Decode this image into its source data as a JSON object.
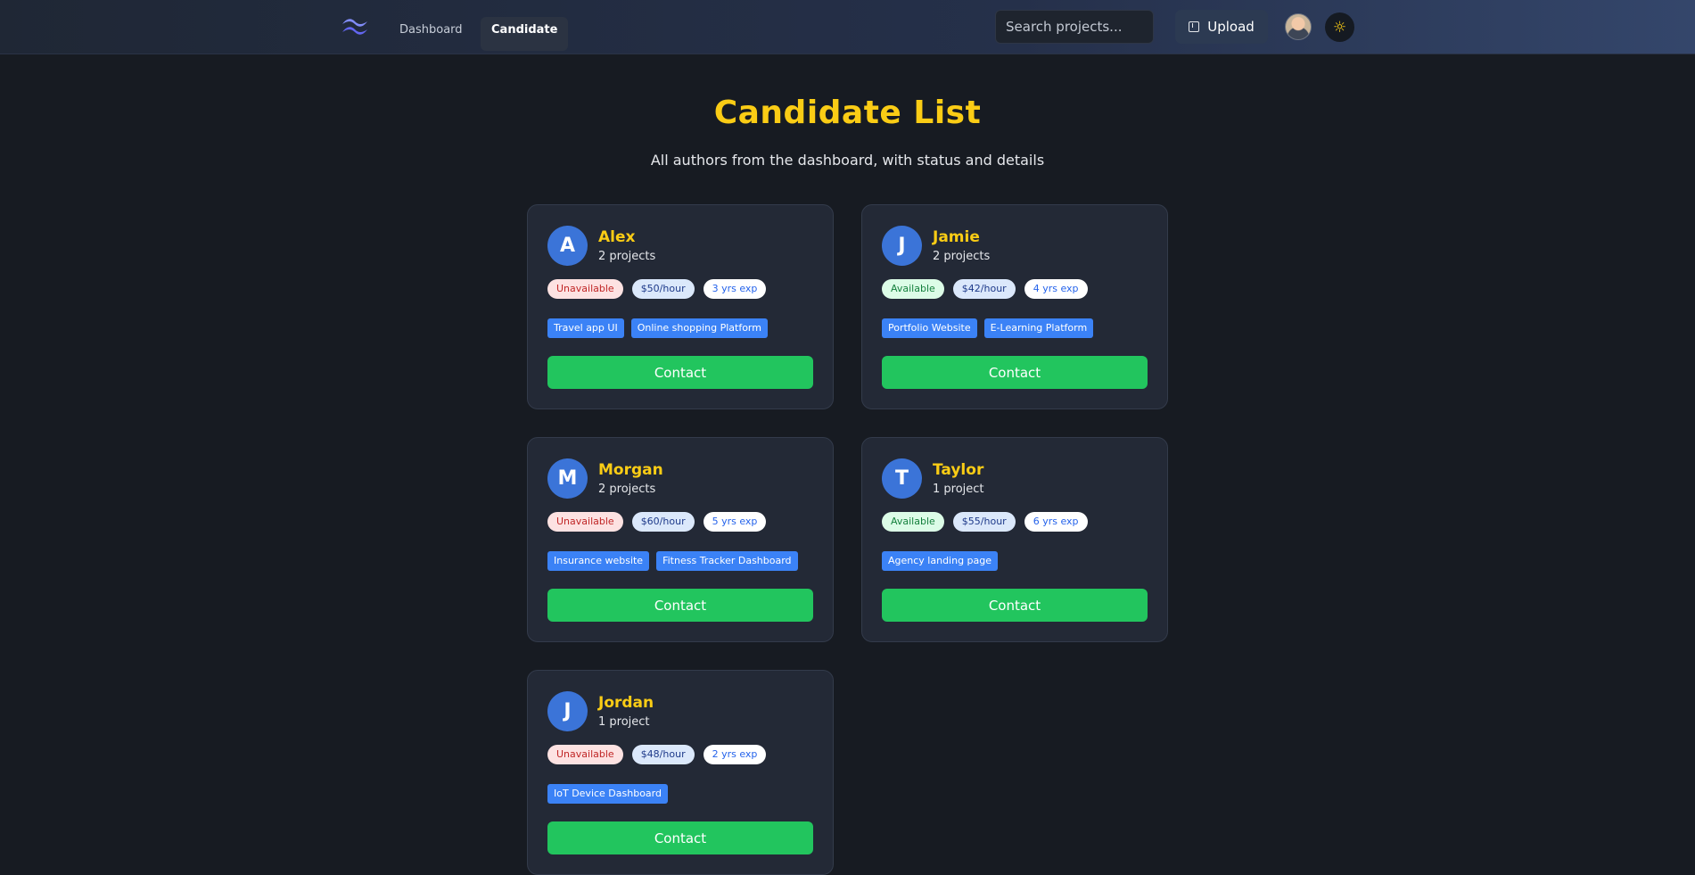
{
  "nav": {
    "links": [
      {
        "label": "Dashboard"
      },
      {
        "label": "Candidate"
      }
    ],
    "search_placeholder": "Search projects...",
    "upload_label": "Upload",
    "theme_icon": "☼"
  },
  "header": {
    "title": "Candidate List",
    "subtitle": "All authors from the dashboard, with status and details"
  },
  "candidates": [
    {
      "initial": "A",
      "name": "Alex",
      "projects": "2 projects",
      "status": "Unavailable",
      "rate": "$50/hour",
      "experience": "3 yrs exp",
      "tags": [
        "Travel app UI",
        "Online shopping Platform"
      ],
      "contact_label": "Contact"
    },
    {
      "initial": "J",
      "name": "Jamie",
      "projects": "2 projects",
      "status": "Available",
      "rate": "$42/hour",
      "experience": "4 yrs exp",
      "tags": [
        "Portfolio Website",
        "E-Learning Platform"
      ],
      "contact_label": "Contact"
    },
    {
      "initial": "M",
      "name": "Morgan",
      "projects": "2 projects",
      "status": "Unavailable",
      "rate": "$60/hour",
      "experience": "5 yrs exp",
      "tags": [
        "Insurance website",
        "Fitness Tracker Dashboard"
      ],
      "contact_label": "Contact"
    },
    {
      "initial": "T",
      "name": "Taylor",
      "projects": "1 project",
      "status": "Available",
      "rate": "$55/hour",
      "experience": "6 yrs exp",
      "tags": [
        "Agency landing page"
      ],
      "contact_label": "Contact"
    },
    {
      "initial": "J",
      "name": "Jordan",
      "projects": "1 project",
      "status": "Unavailable",
      "rate": "$48/hour",
      "experience": "2 yrs exp",
      "tags": [
        "IoT Device Dashboard"
      ],
      "contact_label": "Contact"
    }
  ],
  "colors": {
    "accent_yellow": "#facc15",
    "contact_green": "#22c55e",
    "tag_blue": "#3b82f6",
    "avatar_blue": "#3b74d8",
    "background": "#171b22",
    "card": "#232936"
  }
}
